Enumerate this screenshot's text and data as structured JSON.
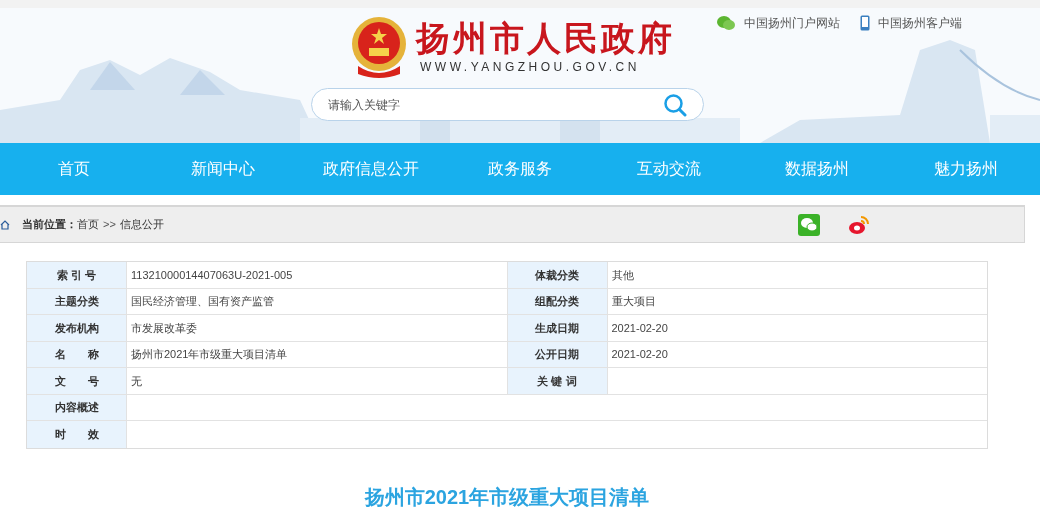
{
  "header": {
    "site_title": "扬州市人民政府",
    "site_url": "WWW.YANGZHOU.GOV.CN",
    "links": [
      {
        "kind": "wechat",
        "label": "中国扬州门户网站"
      },
      {
        "kind": "phone",
        "label": "中国扬州客户端"
      }
    ],
    "search": {
      "placeholder": "请输入关键字"
    }
  },
  "nav": [
    "首页",
    "新闻中心",
    "政府信息公开",
    "政务服务",
    "互动交流",
    "数据扬州",
    "魅力扬州"
  ],
  "breadcrumb": {
    "label": "当前位置：",
    "items": [
      "首页",
      "信息公开"
    ],
    "separator": ">>"
  },
  "info_table": [
    [
      {
        "label": "索 引 号",
        "value": "11321000014407063U-2021-005"
      },
      {
        "label": "体裁分类",
        "value": "其他"
      }
    ],
    [
      {
        "label": "主题分类",
        "value": "国民经济管理、国有资产监管"
      },
      {
        "label": "组配分类",
        "value": "重大项目"
      }
    ],
    [
      {
        "label": "发布机构",
        "value": "市发展改革委"
      },
      {
        "label": "生成日期",
        "value": "2021-02-20"
      }
    ],
    [
      {
        "label": "名　　称",
        "value": "扬州市2021年市级重大项目清单"
      },
      {
        "label": "公开日期",
        "value": "2021-02-20"
      }
    ],
    [
      {
        "label": "文　　号",
        "value": "无"
      },
      {
        "label": "关 键 词"
      }
    ],
    [
      {
        "label": "内容概述"
      }
    ],
    [
      {
        "label": "时　　效"
      }
    ]
  ],
  "article_title": "扬州市2021年市级重大项目清单"
}
